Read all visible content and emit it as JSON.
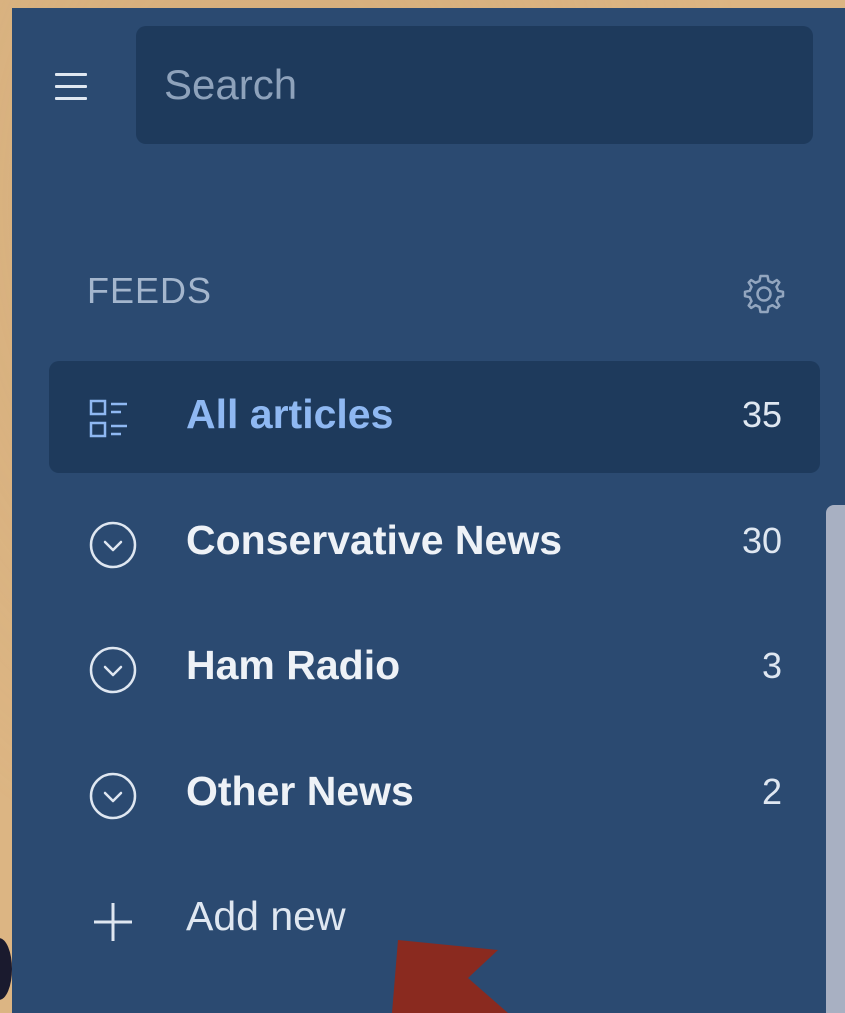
{
  "search": {
    "placeholder": "Search",
    "value": ""
  },
  "sidebar": {
    "section_label": "FEEDS",
    "feeds": [
      {
        "label": "All articles",
        "count": "35",
        "icon": "list-icon",
        "active": true
      },
      {
        "label": "Conservative News",
        "count": "30",
        "icon": "chevron-circle-down-icon",
        "active": false
      },
      {
        "label": "Ham Radio",
        "count": "3",
        "icon": "chevron-circle-down-icon",
        "active": false
      },
      {
        "label": "Other News",
        "count": "2",
        "icon": "chevron-circle-down-icon",
        "active": false
      }
    ],
    "add_label": "Add new"
  },
  "colors": {
    "panel_bg": "#2b4a71",
    "active_bg": "#1e3a5c",
    "active_text": "#8fb8f2",
    "annotation_arrow": "#8a2a1f"
  }
}
